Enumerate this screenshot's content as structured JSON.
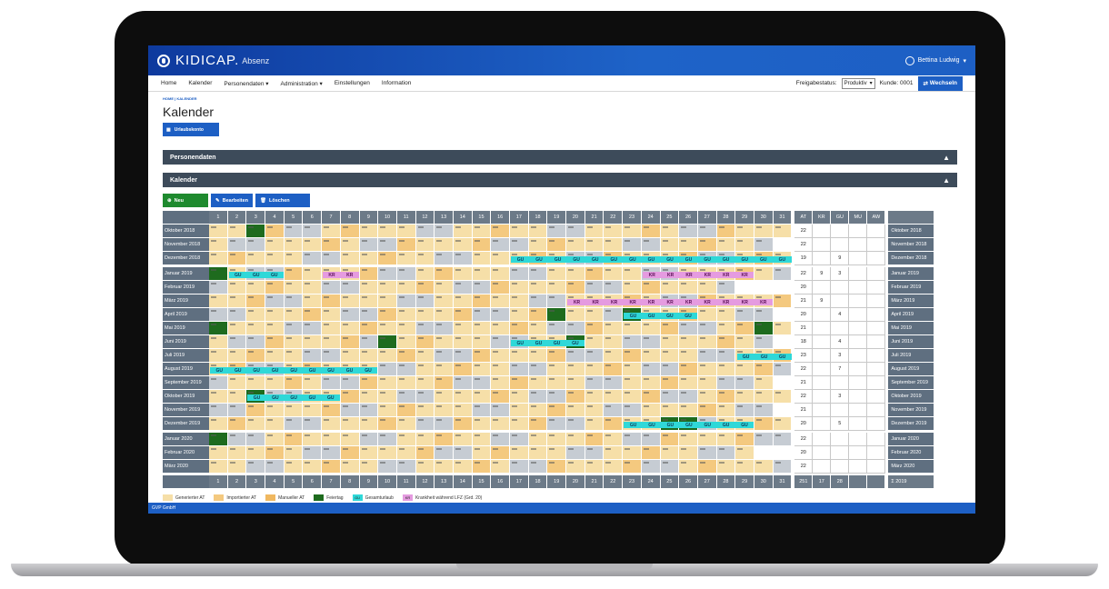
{
  "app": {
    "logo_text": "KIDICAP.",
    "logo_sub": "Absenz",
    "user_name": "Bettina Ludwig"
  },
  "nav": {
    "items": [
      "Home",
      "Kalender",
      "Personendaten ▾",
      "Administration ▾",
      "Einstellungen",
      "Information"
    ],
    "status_label": "Freigabestatus:",
    "status_value": "Produktiv",
    "customer_label": "Kunde: 0001",
    "switch_label": "Wechseln"
  },
  "breadcrumb": "HOME | KALENDER",
  "page_title": "Kalender",
  "urlaub_button": "Urlaubskonto",
  "sections": {
    "personendaten": "Personendaten",
    "kalender": "Kalender"
  },
  "actions": {
    "new": "Neu",
    "edit": "Bearbeiten",
    "delete": "Löschen"
  },
  "calendar": {
    "days": [
      "1",
      "2",
      "3",
      "4",
      "5",
      "6",
      "7",
      "8",
      "9",
      "10",
      "11",
      "12",
      "13",
      "14",
      "15",
      "16",
      "17",
      "18",
      "19",
      "20",
      "21",
      "22",
      "23",
      "24",
      "25",
      "26",
      "27",
      "28",
      "29",
      "30",
      "31"
    ],
    "stat_headers": [
      "AT",
      "KR",
      "GU",
      "MU",
      "AW"
    ],
    "months": [
      {
        "label": "Oktober 2018",
        "at": "22",
        "kr": "",
        "gu": ""
      },
      {
        "label": "November 2018",
        "at": "22",
        "kr": "",
        "gu": ""
      },
      {
        "label": "Dezember 2018",
        "at": "19",
        "kr": "",
        "gu": "9"
      },
      {
        "label": "Januar 2019",
        "at": "22",
        "kr": "9",
        "gu": "3"
      },
      {
        "label": "Februar 2019",
        "at": "20",
        "kr": "",
        "gu": ""
      },
      {
        "label": "März 2019",
        "at": "21",
        "kr": "9",
        "gu": ""
      },
      {
        "label": "April 2019",
        "at": "20",
        "kr": "",
        "gu": "4"
      },
      {
        "label": "Mai 2019",
        "at": "21",
        "kr": "",
        "gu": ""
      },
      {
        "label": "Juni 2019",
        "at": "18",
        "kr": "",
        "gu": "4"
      },
      {
        "label": "Juli 2019",
        "at": "23",
        "kr": "",
        "gu": "3"
      },
      {
        "label": "August 2019",
        "at": "22",
        "kr": "",
        "gu": "7"
      },
      {
        "label": "September 2019",
        "at": "21",
        "kr": "",
        "gu": ""
      },
      {
        "label": "Oktober 2019",
        "at": "22",
        "kr": "",
        "gu": "3"
      },
      {
        "label": "November 2019",
        "at": "21",
        "kr": "",
        "gu": ""
      },
      {
        "label": "Dezember 2019",
        "at": "20",
        "kr": "",
        "gu": "5"
      },
      {
        "label": "Januar 2020",
        "at": "22",
        "kr": "",
        "gu": ""
      },
      {
        "label": "Februar 2020",
        "at": "20",
        "kr": "",
        "gu": ""
      },
      {
        "label": "März 2020",
        "at": "22",
        "kr": "",
        "gu": ""
      }
    ],
    "totals": {
      "at": "251",
      "kr": "17",
      "gu": "28",
      "label": "Σ 2019"
    },
    "bands": [
      {
        "month": 2,
        "from": 17,
        "to": 31,
        "type": "gu",
        "text": "GU"
      },
      {
        "month": 3,
        "from": 2,
        "to": 4,
        "type": "gu",
        "text": "GU"
      },
      {
        "month": 3,
        "from": 7,
        "to": 8,
        "type": "kr",
        "text": "KR"
      },
      {
        "month": 3,
        "from": 24,
        "to": 29,
        "type": "kr",
        "text": "KR"
      },
      {
        "month": 5,
        "from": 20,
        "to": 30,
        "type": "kr",
        "text": "KR"
      },
      {
        "month": 6,
        "from": 23,
        "to": 26,
        "type": "gu",
        "text": "GU"
      },
      {
        "month": 8,
        "from": 17,
        "to": 20,
        "type": "gu",
        "text": "GU"
      },
      {
        "month": 9,
        "from": 29,
        "to": 31,
        "type": "gu",
        "text": "GU"
      },
      {
        "month": 10,
        "from": 1,
        "to": 9,
        "type": "gu",
        "text": "GU"
      },
      {
        "month": 12,
        "from": 3,
        "to": 7,
        "type": "gu",
        "text": "GU"
      },
      {
        "month": 14,
        "from": 23,
        "to": 29,
        "type": "gu",
        "text": "GU"
      }
    ],
    "holidays": [
      [
        0,
        3
      ],
      [
        3,
        1
      ],
      [
        6,
        19
      ],
      [
        6,
        23
      ],
      [
        7,
        1
      ],
      [
        7,
        30
      ],
      [
        8,
        10
      ],
      [
        8,
        20
      ],
      [
        12,
        3
      ],
      [
        14,
        25
      ],
      [
        14,
        26
      ],
      [
        15,
        1
      ]
    ]
  },
  "legend": [
    {
      "label": "Generierter AT",
      "color": "#f6dfa8",
      "code": ""
    },
    {
      "label": "Importierter AT",
      "color": "#f4c97f",
      "code": ""
    },
    {
      "label": "Manueller AT",
      "color": "#f0b860",
      "code": ""
    },
    {
      "label": "Feiertag",
      "color": "#1e6b1e",
      "code": ""
    },
    {
      "label": "Gesamturlaub",
      "color": "#2fd8d8",
      "code": "GU"
    },
    {
      "label": "Krankheit während LFZ (Grd. 20)",
      "color": "#e59be0",
      "code": "KR"
    }
  ],
  "footer": "GVP GmbH",
  "colors": {
    "brand": "#1d5fc4",
    "new_button": "#1e8a2e",
    "section_bar": "#3d4b5a"
  }
}
